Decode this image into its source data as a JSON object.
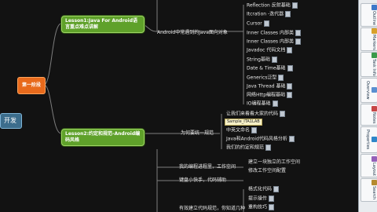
{
  "mindmap": {
    "root_label": "开发",
    "stage_label": "第一阶段",
    "lesson1_title": "Lesson1:Java For Android语言重点难点讲解",
    "lesson1_branch": "Android中常遇到的Java面向对象",
    "lesson1_items": [
      "Reflection 反射基础",
      "Itcration -迭代器",
      "Cursor",
      "Inner Classes 内部类",
      "Inner Classes 内部类",
      "Javadoc 代码文档",
      "String基础",
      "Date & Time基础",
      "Generics泛型",
      "Java Thread 基础",
      "网络Http编程基础",
      "IO编程基础"
    ],
    "lesson2_title": "Lesson2:约定和规范-Android编码风格",
    "lesson2_branch": "为何要统一规范",
    "lesson2_items": [
      "让我们来看看大家的代码",
      "中英文命名",
      "Java和Android代码风格分析",
      "我们的约定和规范"
    ],
    "tooltip_text": "Sample_ITA1LAB",
    "lower_branch_1": "我的编程进程里，工作空间",
    "lower_branch_2": "键盘小快手，代码辅助",
    "lower_items_1": [
      "建立一块独立的工作空间",
      "修改工作空间配置"
    ],
    "lower_items_2": [
      "格式化代码",
      "提示操作",
      "重构技巧"
    ],
    "lower_branch_3": "有效建立代码规范，你知道几种"
  },
  "sidebar": {
    "buttons": [
      "Outline",
      "Markers",
      "Task Info",
      "Overview",
      "Notes",
      "Properties",
      "Layout",
      "Search"
    ],
    "colors": [
      "#3d78c8",
      "#d8a12a",
      "#3b9a4a",
      "#5a8fd0",
      "#c64646",
      "#2f86c9",
      "#9460b8",
      "#b58a2f"
    ]
  }
}
